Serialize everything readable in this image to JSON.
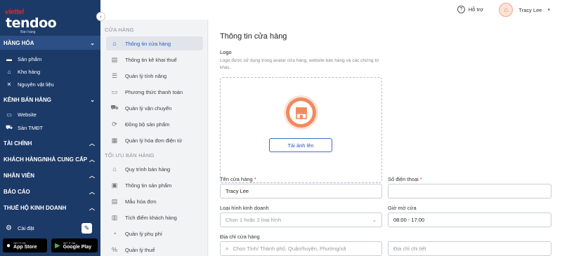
{
  "brand": {
    "viettel": "viettel",
    "tendoo": "tendoo",
    "sub": "Bán hàng"
  },
  "collapse_icon": "chevron-left-icon",
  "sidebar": {
    "sections": [
      {
        "label": "HÀNG HÓA",
        "chev": "⌄"
      },
      {
        "label": "KÊNH BÁN HÀNG",
        "chev": "⌄"
      },
      {
        "label": "TÀI CHÍNH",
        "chev": "^"
      },
      {
        "label": "KHÁCH HÀNG/NHÀ CUNG CẤP",
        "chev": "^"
      },
      {
        "label": "NHÂN VIÊN",
        "chev": "^"
      },
      {
        "label": "BÁO CÁO",
        "chev": "^"
      },
      {
        "label": "THUẾ HỘ KINH DOANH",
        "chev": "^"
      }
    ],
    "hang_hoa_items": [
      {
        "label": "Sản phẩm",
        "icon": "product-icon"
      },
      {
        "label": "Kho hàng",
        "icon": "warehouse-icon"
      },
      {
        "label": "Nguyên vật liệu",
        "icon": "tools-icon"
      }
    ],
    "kenh_items": [
      {
        "label": "Website",
        "icon": "monitor-icon"
      },
      {
        "label": "Sàn TMĐT",
        "icon": "cart-icon"
      }
    ],
    "settings_label": "Cài đặt",
    "app_store": {
      "small": "GET IT ON",
      "big": "App Store"
    },
    "google_play": {
      "small": "GET IT ON",
      "big": "Google Play"
    }
  },
  "topbar": {
    "help_label": "Hỗ trợ",
    "user_name": "Tracy Lee"
  },
  "submenu": {
    "head1": "CỬA HÀNG",
    "items1": [
      {
        "label": "Thông tin cửa hàng",
        "icon": "store-icon",
        "active": true
      },
      {
        "label": "Thông tin kê khai thuế",
        "icon": "document-icon"
      },
      {
        "label": "Quản lý tính năng",
        "icon": "list-icon"
      },
      {
        "label": "Phương thức thanh toán",
        "icon": "card-icon"
      },
      {
        "label": "Quản lý vận chuyển",
        "icon": "truck-icon"
      },
      {
        "label": "Đồng bộ sản phẩm",
        "icon": "sync-icon"
      },
      {
        "label": "Quản lý hóa đơn điện tử",
        "icon": "invoice-icon"
      }
    ],
    "head2": "TỐI ƯU BÁN HÀNG",
    "items2": [
      {
        "label": "Quy trình bán hàng",
        "icon": "process-icon"
      },
      {
        "label": "Thông tin sản phẩm",
        "icon": "box-icon"
      },
      {
        "label": "Mẫu hóa đơn",
        "icon": "template-icon"
      },
      {
        "label": "Tích điểm khách hàng",
        "icon": "points-icon"
      },
      {
        "label": "Quản lý phụ phí",
        "icon": "fee-icon"
      },
      {
        "label": "Quản lý thuế",
        "icon": "percent-icon"
      }
    ]
  },
  "main": {
    "title": "Thông tin cửa hàng",
    "logo_label": "Logo",
    "logo_desc": "Logo được sử dụng trong avatar cửa hàng, website bán hàng và các chứng từ khác.",
    "upload_label": "Tải ảnh lên",
    "store_name_label": "Tên cửa hàng",
    "store_name_value": "Tracy Lee",
    "phone_label": "Số điện thoại",
    "phone_value": "",
    "biz_type_label": "Loại hình kinh doanh",
    "biz_type_placeholder": "Chọn 1 hoặc 2 loại hình",
    "open_hours_label": "Giờ mở cửa",
    "open_hours_value": "08:00 - 17:00",
    "address_label": "Địa chỉ cửa hàng",
    "address_placeholder": "Chọn Tỉnh/ Thành phố, Quận/huyện, Phường/xã",
    "detail_placeholder": "Địa chỉ chi tiết",
    "required_mark": "*"
  },
  "colors": {
    "sidebar": "#1c3a68",
    "accent": "#1f5fbf",
    "orange": "#f18a5e"
  }
}
